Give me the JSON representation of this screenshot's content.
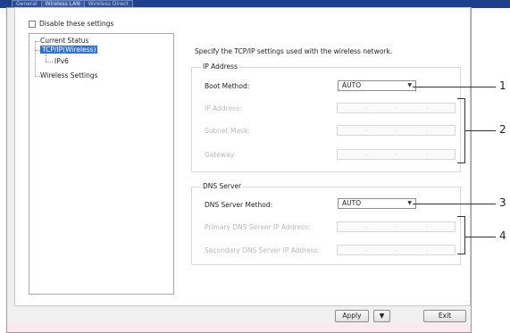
{
  "tabs": [
    "General",
    "Wireless LAN",
    "Wireless Direct"
  ],
  "disable_checkbox": {
    "label": "Disable these settings",
    "checked": false
  },
  "tree": {
    "items": [
      "Current Status",
      "TCP/IP(Wireless)",
      "IPv6",
      "Wireless Settings"
    ],
    "selected": "TCP/IP(Wireless)"
  },
  "description": "Specify the TCP/IP settings used with the wireless network.",
  "ip_group": {
    "title": "IP Address",
    "boot_method_label": "Boot Method:",
    "boot_method_value": "AUTO",
    "ip_address_label": "IP Address:",
    "subnet_mask_label": "Subnet Mask:",
    "gateway_label": "Gateway:"
  },
  "dns_group": {
    "title": "DNS Server",
    "dns_method_label": "DNS Server Method:",
    "dns_method_value": "AUTO",
    "primary_label": "Primary DNS Server IP Address:",
    "secondary_label": "Secondary DNS Server IP Address:"
  },
  "ip_dot": ".",
  "buttons": {
    "apply": "Apply",
    "exit": "Exit"
  },
  "callouts": [
    "1",
    "2",
    "3",
    "4"
  ],
  "colors": {
    "title_bar": "#1e3f8c",
    "selection": "#2f6fd8"
  }
}
